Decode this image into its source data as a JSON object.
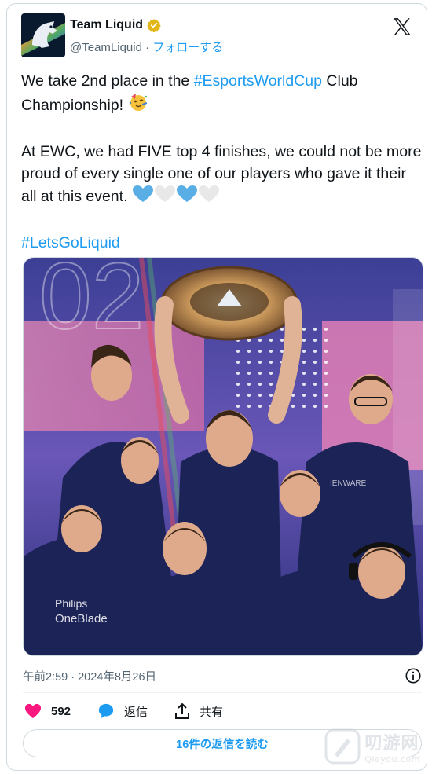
{
  "account": {
    "display_name": "Team Liquid",
    "handle": "@TeamLiquid",
    "separator": " · ",
    "follow_label": "フォローする",
    "avatar_icon": "team-liquid-horse-logo",
    "verified_icon": "gold-verified-badge"
  },
  "tweet": {
    "line1_pre": "We take 2nd place in the ",
    "line1_hashtag": "#EsportsWorldCup",
    "line1_post": " Club Championship! ",
    "line1_emoji": "party-face",
    "para2": "At EWC, we had FIVE top 4 finishes, we could not be more proud of every single one of our players who gave it their all at this event. ",
    "para2_emojis": [
      "blue-heart",
      "white-heart",
      "blue-heart",
      "white-heart"
    ],
    "hashtag_footer": "#LetsGoLiquid"
  },
  "media": {
    "description_icon": "team-photo-with-trophy"
  },
  "meta": {
    "timestamp": "午前2:59 · 2024年8月26日",
    "info_icon": "info-icon"
  },
  "actions": {
    "likes_count": "592",
    "reply_label": "返信",
    "share_label": "共有"
  },
  "replies_button": "16件の返信を読む",
  "watermark": {
    "big": "叨游网",
    "small": "Qieyou.com"
  },
  "colors": {
    "accent": "#1d9bf0",
    "like": "#f91880",
    "text": "#0f1419",
    "secondary": "#536471"
  }
}
